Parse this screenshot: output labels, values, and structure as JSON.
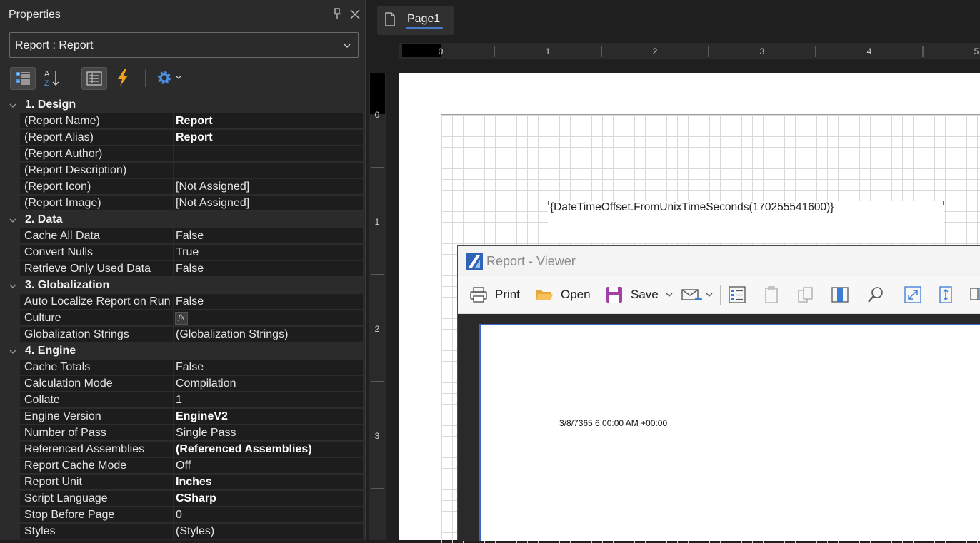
{
  "properties": {
    "title": "Properties",
    "selected_object": "Report : Report",
    "toolbar": {
      "categorized": "categorized-icon",
      "alphabetical": "sort-az-icon",
      "properties": "property-list-icon",
      "events": "lightning-icon",
      "settings": "gear-icon"
    },
    "categories": [
      {
        "label": "1. Design",
        "items": [
          {
            "name": "(Report Name)",
            "value": "Report",
            "bold": true
          },
          {
            "name": "(Report Alias)",
            "value": "Report",
            "bold": true
          },
          {
            "name": "(Report Author)",
            "value": ""
          },
          {
            "name": "(Report Description)",
            "value": ""
          },
          {
            "name": "(Report Icon)",
            "value": "[Not Assigned]"
          },
          {
            "name": "(Report Image)",
            "value": "[Not Assigned]"
          }
        ]
      },
      {
        "label": "2. Data",
        "items": [
          {
            "name": "Cache All Data",
            "value": "False"
          },
          {
            "name": "Convert Nulls",
            "value": "True"
          },
          {
            "name": "Retrieve Only Used Data",
            "value": "False"
          }
        ]
      },
      {
        "label": "3. Globalization",
        "items": [
          {
            "name": "Auto Localize Report on Run",
            "value": "False"
          },
          {
            "name": "Culture",
            "value": "",
            "fx": "fx"
          },
          {
            "name": "Globalization Strings",
            "value": "(Globalization Strings)"
          }
        ]
      },
      {
        "label": "4. Engine",
        "items": [
          {
            "name": "Cache Totals",
            "value": "False"
          },
          {
            "name": "Calculation Mode",
            "value": "Compilation"
          },
          {
            "name": "Collate",
            "value": "1"
          },
          {
            "name": "Engine Version",
            "value": "EngineV2",
            "bold": true
          },
          {
            "name": "Number of Pass",
            "value": "Single Pass"
          },
          {
            "name": "Referenced Assemblies",
            "value": "(Referenced Assemblies)",
            "bold": true
          },
          {
            "name": "Report Cache Mode",
            "value": "Off"
          },
          {
            "name": "Report Unit",
            "value": "Inches",
            "bold": true
          },
          {
            "name": "Script Language",
            "value": "CSharp",
            "bold": true
          },
          {
            "name": "Stop Before Page",
            "value": "0"
          },
          {
            "name": "Styles",
            "value": "(Styles)"
          }
        ]
      }
    ]
  },
  "designer": {
    "tab_label": "Page1",
    "hruler_labels": [
      "0",
      "1",
      "2",
      "3",
      "4",
      "5"
    ],
    "vruler_labels": [
      "0",
      "1",
      "2",
      "3"
    ],
    "textbox_expression": "{DateTimeOffset.FromUnixTimeSeconds(170255541600)}"
  },
  "viewer": {
    "title": "Report - Viewer",
    "print_label": "Print",
    "open_label": "Open",
    "save_label": "Save",
    "page_text": "3/8/7365 6:00:00 AM +00:00"
  }
}
